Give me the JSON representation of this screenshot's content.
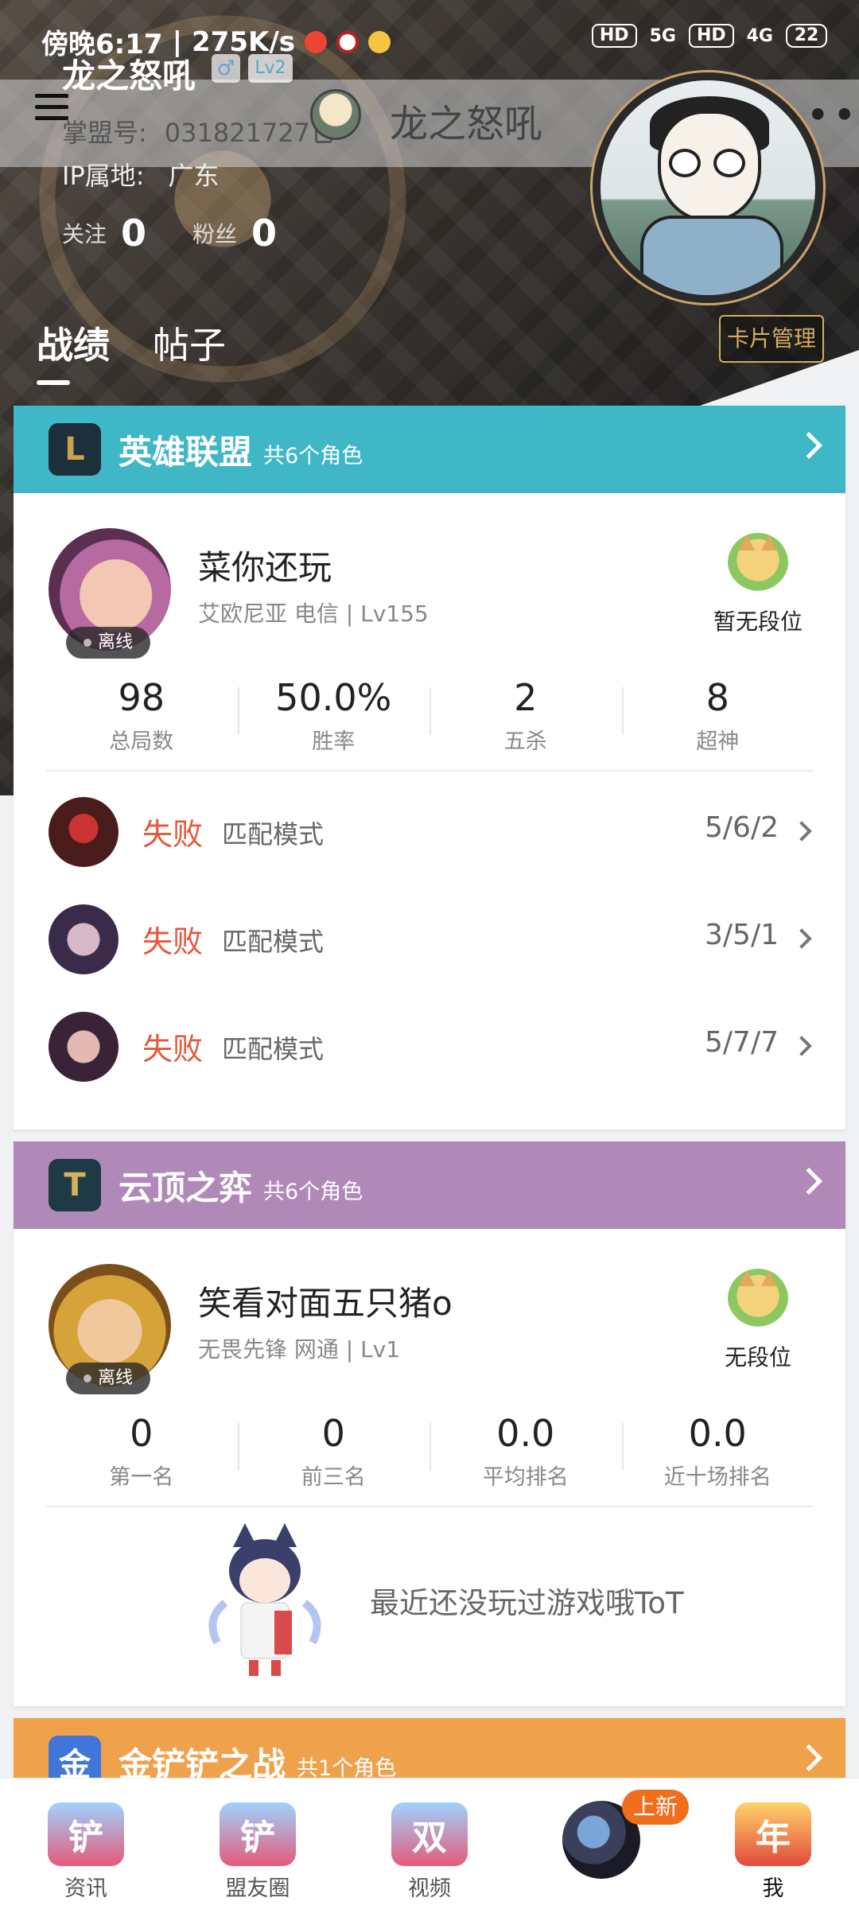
{
  "status": {
    "time_text": "傍晚6:17",
    "speed": "275K/s",
    "sim1_hd": "HD",
    "sim1_net": "5G",
    "sim2_hd": "HD",
    "sim2_net": "4G",
    "battery": "22"
  },
  "profile": {
    "name": "龙之怒吼",
    "gender": "♂",
    "level": "Lv2",
    "account_label": "掌盟号:",
    "account_id": "031821727",
    "title_name": "龙之怒吼",
    "ip_label": "IP属地:",
    "ip_value": "广东",
    "follow_label": "关注",
    "follow_count": "0",
    "fans_label": "粉丝",
    "fans_count": "0"
  },
  "tabs": [
    {
      "label": "战绩",
      "active": true
    },
    {
      "label": "帖子",
      "active": false
    }
  ],
  "card_manage": "卡片管理",
  "lol": {
    "title": "英雄联盟",
    "sub": "共6个角色",
    "color": "#3fb7c7",
    "role_name": "菜你还玩",
    "role_info": "艾欧尼亚 电信 | Lv155",
    "status": "离线",
    "rank": "暂无段位",
    "stats": [
      {
        "value": "98",
        "label": "总局数"
      },
      {
        "value": "50.0%",
        "label": "胜率"
      },
      {
        "value": "2",
        "label": "五杀"
      },
      {
        "value": "8",
        "label": "超神"
      }
    ],
    "matches": [
      {
        "result": "失败",
        "mode": "匹配模式",
        "kda": "5/6/2"
      },
      {
        "result": "失败",
        "mode": "匹配模式",
        "kda": "3/5/1"
      },
      {
        "result": "失败",
        "mode": "匹配模式",
        "kda": "5/7/7"
      }
    ]
  },
  "tft": {
    "title": "云顶之弈",
    "sub": "共6个角色",
    "color": "#b089b9",
    "role_name": "笑看对面五只猪o",
    "role_info": "无畏先锋 网通 | Lv1",
    "status": "离线",
    "rank": "无段位",
    "stats": [
      {
        "value": "0",
        "label": "第一名"
      },
      {
        "value": "0",
        "label": "前三名"
      },
      {
        "value": "0.0",
        "label": "平均排名"
      },
      {
        "value": "0.0",
        "label": "近十场排名"
      }
    ],
    "empty_text": "最近还没玩过游戏哦ToT"
  },
  "jcc": {
    "title": "金铲铲之战",
    "sub": "共1个角色",
    "color": "#efa14c"
  },
  "nav": [
    {
      "label": "资讯",
      "icon_text": "铲",
      "icon": "news-icon"
    },
    {
      "label": "盟友圈",
      "icon_text": "铲",
      "icon": "friends-icon"
    },
    {
      "label": "视频",
      "icon_text": "双",
      "icon": "video-icon"
    },
    {
      "label": "",
      "icon_text": "",
      "icon": "center-avatar-icon"
    },
    {
      "label": "我",
      "icon_text": "年",
      "icon": "me-icon"
    }
  ],
  "nav_new_badge": "上新"
}
